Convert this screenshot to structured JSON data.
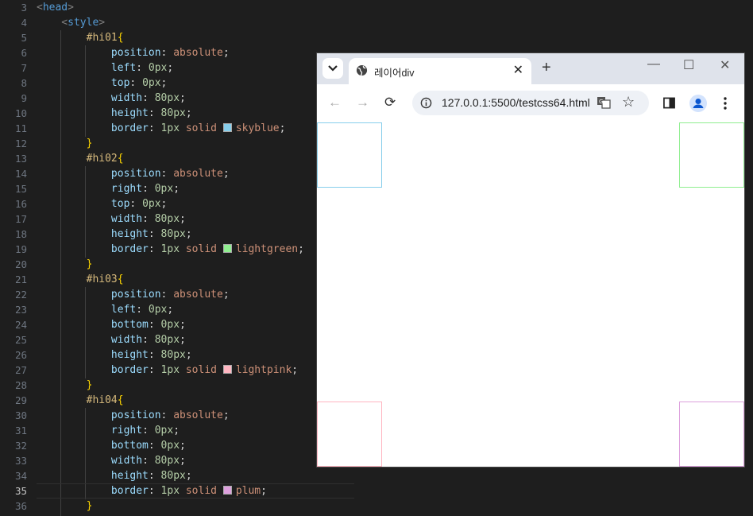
{
  "editor": {
    "line_numbers": [
      "3",
      "4",
      "5",
      "6",
      "7",
      "8",
      "9",
      "10",
      "11",
      "12",
      "13",
      "14",
      "15",
      "16",
      "17",
      "18",
      "19",
      "20",
      "21",
      "22",
      "23",
      "24",
      "25",
      "26",
      "27",
      "28",
      "29",
      "30",
      "31",
      "32",
      "33",
      "34",
      "35",
      "36"
    ],
    "active_line": "35",
    "lines": [
      [
        [
          "br",
          "<"
        ],
        [
          "tag",
          "head"
        ],
        [
          "br",
          ">"
        ]
      ],
      [
        [
          "br",
          "    <"
        ],
        [
          "tag",
          "style"
        ],
        [
          "br",
          ">"
        ]
      ],
      [
        [
          "sel",
          "        #hi01"
        ],
        [
          "brace",
          "{"
        ]
      ],
      [
        [
          "prop",
          "            position"
        ],
        [
          "punc",
          ": "
        ],
        [
          "val",
          "absolute"
        ],
        [
          "punc",
          ";"
        ]
      ],
      [
        [
          "prop",
          "            left"
        ],
        [
          "punc",
          ": "
        ],
        [
          "num",
          "0px"
        ],
        [
          "punc",
          ";"
        ]
      ],
      [
        [
          "prop",
          "            top"
        ],
        [
          "punc",
          ": "
        ],
        [
          "num",
          "0px"
        ],
        [
          "punc",
          ";"
        ]
      ],
      [
        [
          "prop",
          "            width"
        ],
        [
          "punc",
          ": "
        ],
        [
          "num",
          "80px"
        ],
        [
          "punc",
          ";"
        ]
      ],
      [
        [
          "prop",
          "            height"
        ],
        [
          "punc",
          ": "
        ],
        [
          "num",
          "80px"
        ],
        [
          "punc",
          ";"
        ]
      ],
      [
        [
          "prop",
          "            border"
        ],
        [
          "punc",
          ": "
        ],
        [
          "num",
          "1px"
        ],
        [
          "val",
          " solid "
        ],
        [
          "swatch",
          "skyblue"
        ],
        [
          "val",
          "skyblue"
        ],
        [
          "punc",
          ";"
        ]
      ],
      [
        [
          "brace",
          "        }"
        ]
      ],
      [
        [
          "sel",
          "        #hi02"
        ],
        [
          "brace",
          "{"
        ]
      ],
      [
        [
          "prop",
          "            position"
        ],
        [
          "punc",
          ": "
        ],
        [
          "val",
          "absolute"
        ],
        [
          "punc",
          ";"
        ]
      ],
      [
        [
          "prop",
          "            right"
        ],
        [
          "punc",
          ": "
        ],
        [
          "num",
          "0px"
        ],
        [
          "punc",
          ";"
        ]
      ],
      [
        [
          "prop",
          "            top"
        ],
        [
          "punc",
          ": "
        ],
        [
          "num",
          "0px"
        ],
        [
          "punc",
          ";"
        ]
      ],
      [
        [
          "prop",
          "            width"
        ],
        [
          "punc",
          ": "
        ],
        [
          "num",
          "80px"
        ],
        [
          "punc",
          ";"
        ]
      ],
      [
        [
          "prop",
          "            height"
        ],
        [
          "punc",
          ": "
        ],
        [
          "num",
          "80px"
        ],
        [
          "punc",
          ";"
        ]
      ],
      [
        [
          "prop",
          "            border"
        ],
        [
          "punc",
          ": "
        ],
        [
          "num",
          "1px"
        ],
        [
          "val",
          " solid "
        ],
        [
          "swatch",
          "lightgreen"
        ],
        [
          "val",
          "lightgreen"
        ],
        [
          "punc",
          ";"
        ]
      ],
      [
        [
          "brace",
          "        }"
        ]
      ],
      [
        [
          "sel",
          "        #hi03"
        ],
        [
          "brace",
          "{"
        ]
      ],
      [
        [
          "prop",
          "            position"
        ],
        [
          "punc",
          ": "
        ],
        [
          "val",
          "absolute"
        ],
        [
          "punc",
          ";"
        ]
      ],
      [
        [
          "prop",
          "            left"
        ],
        [
          "punc",
          ": "
        ],
        [
          "num",
          "0px"
        ],
        [
          "punc",
          ";"
        ]
      ],
      [
        [
          "prop",
          "            bottom"
        ],
        [
          "punc",
          ": "
        ],
        [
          "num",
          "0px"
        ],
        [
          "punc",
          ";"
        ]
      ],
      [
        [
          "prop",
          "            width"
        ],
        [
          "punc",
          ": "
        ],
        [
          "num",
          "80px"
        ],
        [
          "punc",
          ";"
        ]
      ],
      [
        [
          "prop",
          "            height"
        ],
        [
          "punc",
          ": "
        ],
        [
          "num",
          "80px"
        ],
        [
          "punc",
          ";"
        ]
      ],
      [
        [
          "prop",
          "            border"
        ],
        [
          "punc",
          ": "
        ],
        [
          "num",
          "1px"
        ],
        [
          "val",
          " solid "
        ],
        [
          "swatch",
          "lightpink"
        ],
        [
          "val",
          "lightpink"
        ],
        [
          "punc",
          ";"
        ]
      ],
      [
        [
          "brace",
          "        }"
        ]
      ],
      [
        [
          "sel",
          "        #hi04"
        ],
        [
          "brace",
          "{"
        ]
      ],
      [
        [
          "prop",
          "            position"
        ],
        [
          "punc",
          ": "
        ],
        [
          "val",
          "absolute"
        ],
        [
          "punc",
          ";"
        ]
      ],
      [
        [
          "prop",
          "            right"
        ],
        [
          "punc",
          ": "
        ],
        [
          "num",
          "0px"
        ],
        [
          "punc",
          ";"
        ]
      ],
      [
        [
          "prop",
          "            bottom"
        ],
        [
          "punc",
          ": "
        ],
        [
          "num",
          "0px"
        ],
        [
          "punc",
          ";"
        ]
      ],
      [
        [
          "prop",
          "            width"
        ],
        [
          "punc",
          ": "
        ],
        [
          "num",
          "80px"
        ],
        [
          "punc",
          ";"
        ]
      ],
      [
        [
          "prop",
          "            height"
        ],
        [
          "punc",
          ": "
        ],
        [
          "num",
          "80px"
        ],
        [
          "punc",
          ";"
        ]
      ],
      [
        [
          "prop",
          "            border"
        ],
        [
          "punc",
          ": "
        ],
        [
          "num",
          "1px"
        ],
        [
          "val",
          " solid "
        ],
        [
          "swatch",
          "plum"
        ],
        [
          "val",
          "plum"
        ],
        [
          "punc",
          ";"
        ]
      ],
      [
        [
          "brace",
          "        }"
        ]
      ]
    ]
  },
  "browser": {
    "tab_title": "레이어div",
    "tab_close": "✕",
    "new_tab": "+",
    "window_controls": {
      "minimize": "—",
      "maximize": "☐",
      "close": "✕"
    },
    "nav": {
      "back": "←",
      "forward": "→",
      "reload": "⟳"
    },
    "url": "127.0.0.1:5500/testcss64.html",
    "star": "☆",
    "icons": [
      "tab-search-icon",
      "globe-icon",
      "info-icon",
      "translate-icon",
      "bookmark-star-icon",
      "side-panel-icon",
      "profile-icon",
      "menu-dots-icon"
    ],
    "demo_boxes": [
      {
        "id": "hi01",
        "corner": "top-left",
        "color": "#87ceeb"
      },
      {
        "id": "hi02",
        "corner": "top-right",
        "color": "#90ee90"
      },
      {
        "id": "hi03",
        "corner": "bottom-left",
        "color": "#ffb6c1"
      },
      {
        "id": "hi04",
        "corner": "bottom-right",
        "color": "#dda0dd"
      }
    ]
  }
}
